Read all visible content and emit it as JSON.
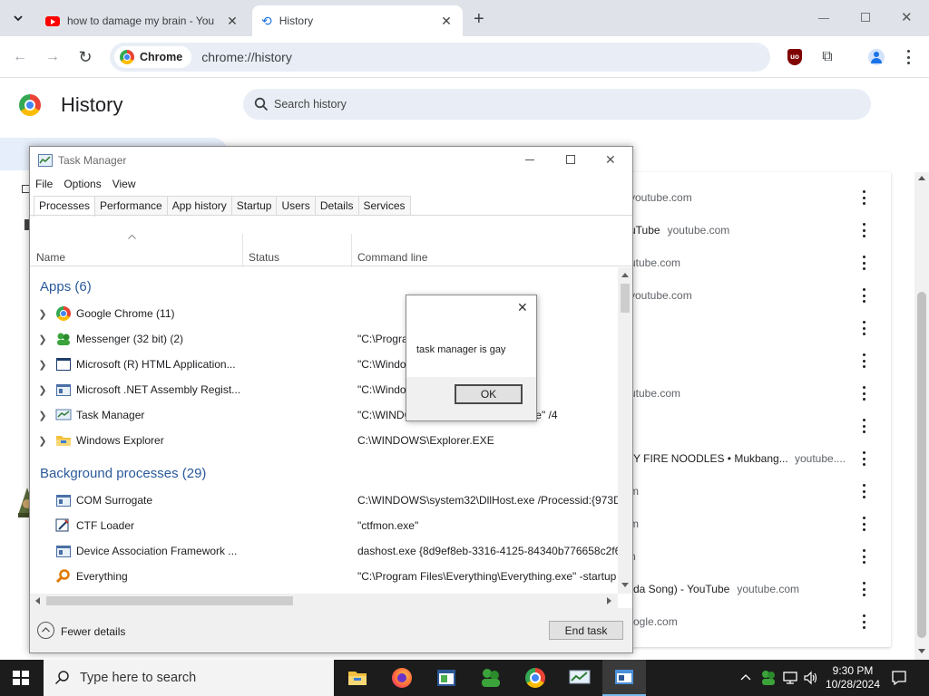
{
  "browser": {
    "tabs": [
      {
        "title": "how to damage my brain - You",
        "active": false
      },
      {
        "title": "History",
        "active": true
      }
    ],
    "omnibox": {
      "chip": "Chrome",
      "url": "chrome://history"
    }
  },
  "history": {
    "title": "History",
    "search_placeholder": "Search history",
    "rows": [
      {
        "title": "",
        "domain": "youtube.com"
      },
      {
        "title": "uTube",
        "domain": "youtube.com"
      },
      {
        "title": "",
        "domain": "utube.com"
      },
      {
        "title": "",
        "domain": "youtube.com"
      },
      {
        "title": "",
        "domain": ""
      },
      {
        "title": "",
        "domain": ""
      },
      {
        "title": "",
        "domain": "utube.com"
      },
      {
        "title": "",
        "domain": ""
      },
      {
        "title": "Y FIRE NOODLES • Mukbang...",
        "domain": "youtube...."
      },
      {
        "title": "",
        "domain": "m"
      },
      {
        "title": "",
        "domain": "m"
      },
      {
        "title": "",
        "domain": "n"
      },
      {
        "title": "da Song) - YouTube",
        "domain": "youtube.com"
      },
      {
        "title": "",
        "domain": "ogle.com"
      }
    ]
  },
  "task_manager": {
    "title": "Task Manager",
    "menu": [
      "File",
      "Options",
      "View"
    ],
    "tabs": [
      "Processes",
      "Performance",
      "App history",
      "Startup",
      "Users",
      "Details",
      "Services"
    ],
    "columns": {
      "name": "Name",
      "status": "Status",
      "command": "Command line"
    },
    "apps_group": "Apps (6)",
    "apps": [
      {
        "name": "Google Chrome (11)",
        "cmd": "",
        "icon": "chrome-icon"
      },
      {
        "name": "Messenger (32 bit) (2)",
        "cmd": "\"C:\\Progra                           ger\\msnmsgr.exe",
        "icon": "messenger-icon"
      },
      {
        "name": "Microsoft (R) HTML Application...",
        "cmd": "\"C:\\Windo                        \" \"C:\\Users\\Jack F",
        "icon": "hta-icon"
      },
      {
        "name": "Microsoft .NET Assembly Regist...",
        "cmd": "\"C:\\Windo                       ork\\v4.0.30319\\R",
        "icon": "window-icon"
      },
      {
        "name": "Task Manager",
        "cmd": "\"C:\\WINDOWS\\system32\\taskmgr.exe\" /4",
        "icon": "taskmgr-icon"
      },
      {
        "name": "Windows Explorer",
        "cmd": "C:\\WINDOWS\\Explorer.EXE",
        "icon": "folder-icon"
      }
    ],
    "bg_group": "Background processes (29)",
    "background": [
      {
        "name": "COM Surrogate",
        "cmd": "C:\\WINDOWS\\system32\\DllHost.exe /Processid:{973D2",
        "icon": "window-icon"
      },
      {
        "name": "CTF Loader",
        "cmd": "\"ctfmon.exe\"",
        "icon": "ctf-icon"
      },
      {
        "name": "Device Association Framework ...",
        "cmd": "dashost.exe {8d9ef8eb-3316-4125-84340b776658c2f6}",
        "icon": "window-icon"
      },
      {
        "name": "Everything",
        "cmd": "\"C:\\Program Files\\Everything\\Everything.exe\" -startup",
        "icon": "search-icon"
      }
    ],
    "fewer_details": "Fewer details",
    "end_task": "End task"
  },
  "dialog": {
    "message": "task manager is gay",
    "ok": "OK"
  },
  "taskbar": {
    "search_placeholder": "Type here to search",
    "time": "9:30 PM",
    "date": "10/28/2024"
  }
}
